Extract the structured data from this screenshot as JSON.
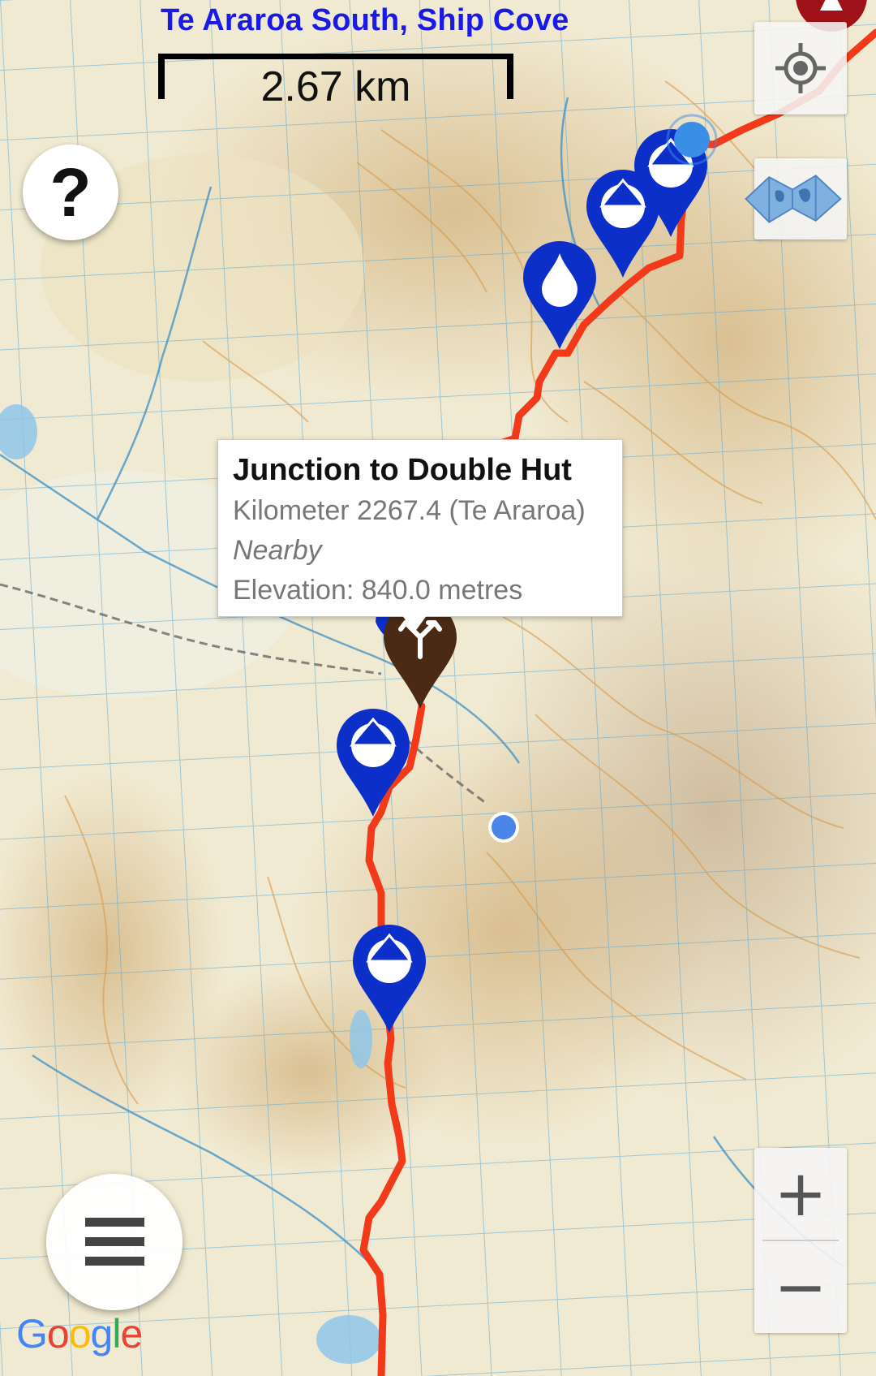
{
  "map": {
    "section_title": "Te Araroa South, Ship Cove",
    "scale_label": "2.67 km",
    "route_color": "#f23a1a",
    "water_pin_color": "#0d2fc9",
    "junction_pin_color": "#4a2a14",
    "poi_pins": [
      {
        "type": "water-drop",
        "variant": "full"
      },
      {
        "type": "water-drop",
        "variant": "half"
      },
      {
        "type": "water-drop",
        "variant": "half"
      },
      {
        "type": "water-drop",
        "variant": "half"
      },
      {
        "type": "water-drop",
        "variant": "half"
      },
      {
        "type": "junction"
      }
    ]
  },
  "controls": {
    "help_label": "?",
    "zoom_in_label": "+",
    "zoom_out_label": "−",
    "locate_icon": "crosshair-icon",
    "layers_icon": "map-layers-icon",
    "menu_icon": "hamburger-icon"
  },
  "info_window": {
    "title": "Junction to Double Hut",
    "kilometer": "Kilometer 2267.4 (Te Araroa)",
    "nearby": "Nearby",
    "elevation": "Elevation: 840.0 metres"
  },
  "attribution": {
    "logo_letters": [
      "G",
      "o",
      "o",
      "g",
      "l",
      "e"
    ],
    "logo_colors": [
      "#4285f4",
      "#ea4335",
      "#fbbc05",
      "#4285f4",
      "#34a853",
      "#ea4335"
    ]
  }
}
